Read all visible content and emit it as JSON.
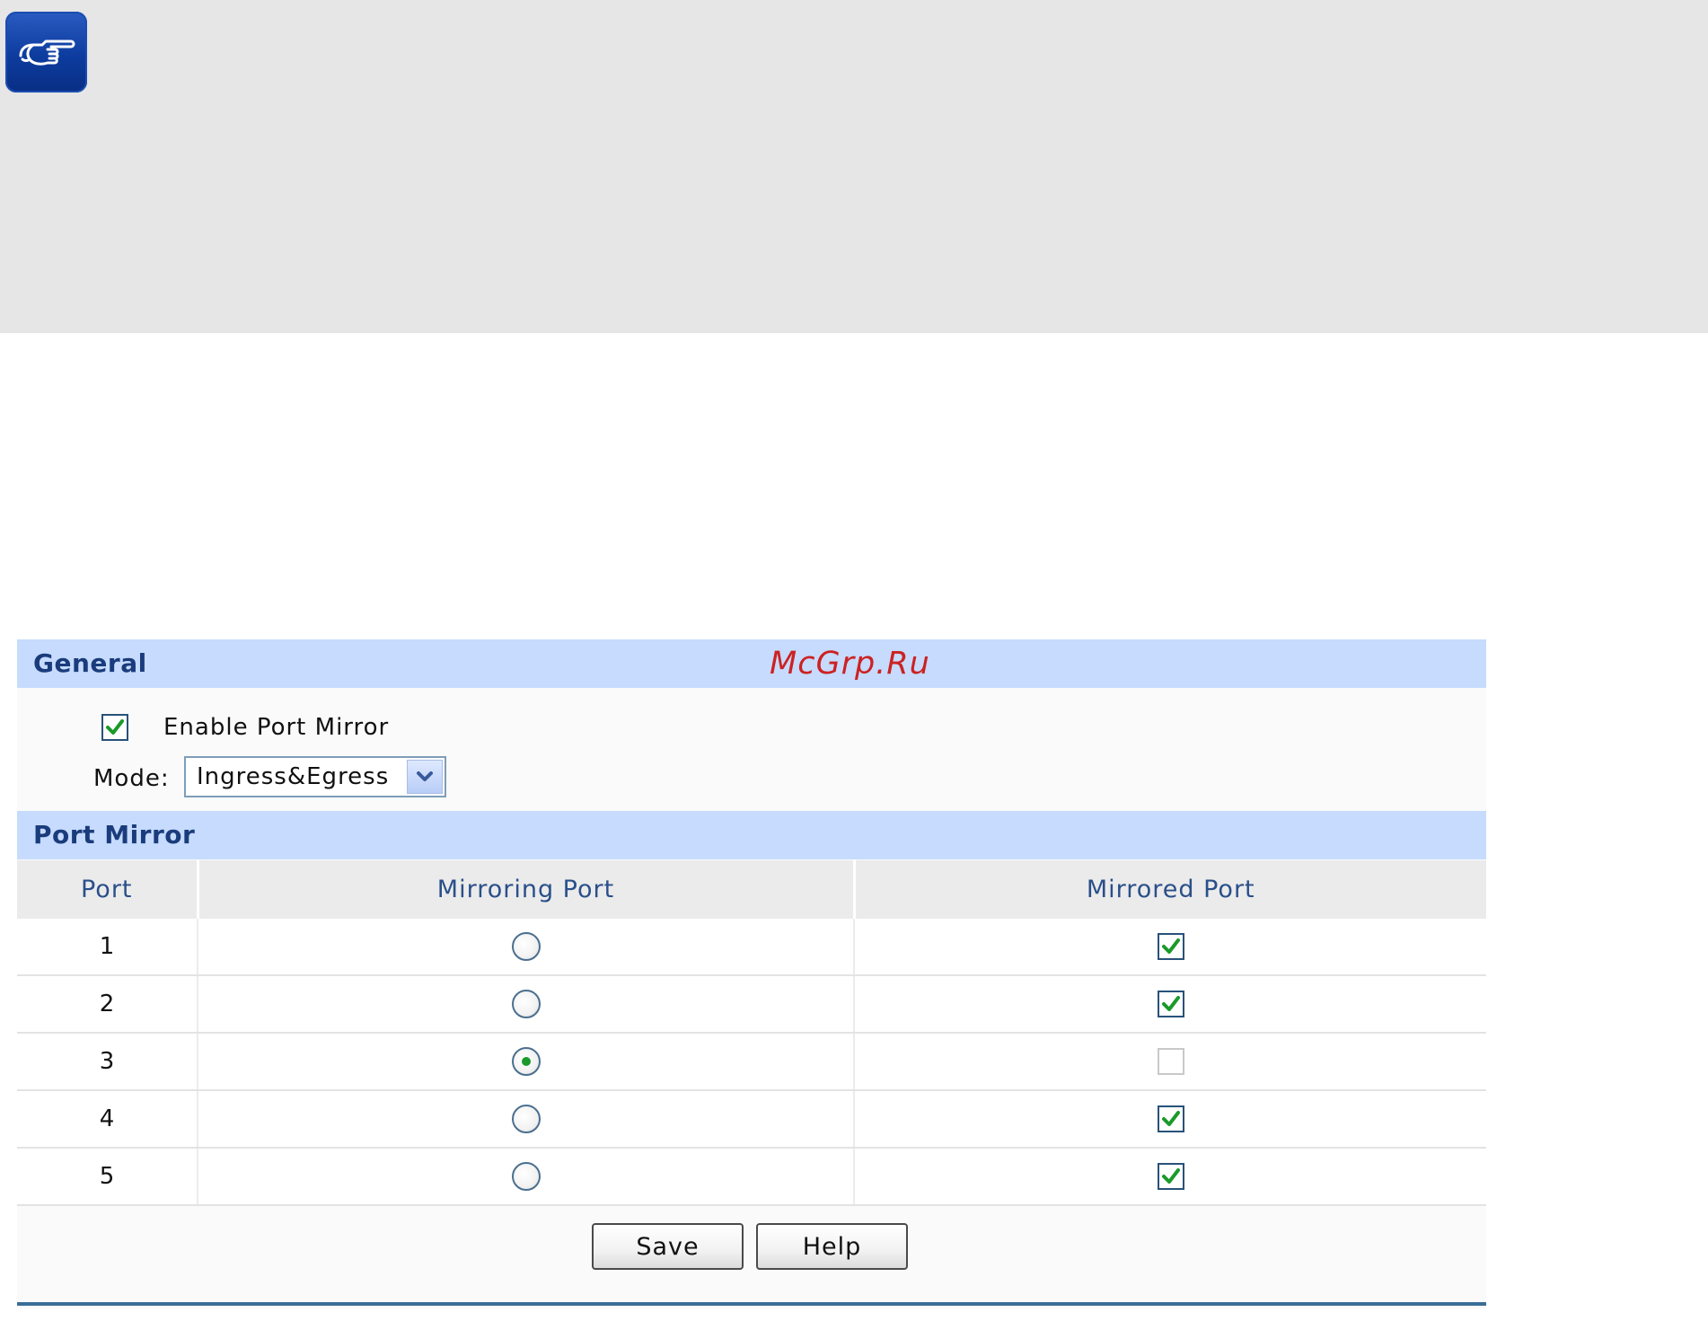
{
  "general": {
    "title": "General",
    "watermark": "McGrp.Ru",
    "enable_port_mirror": {
      "label": "Enable Port Mirror",
      "checked": true
    },
    "mode": {
      "label": "Mode:",
      "value": "Ingress&Egress"
    }
  },
  "port_mirror": {
    "title": "Port Mirror",
    "columns": {
      "port": "Port",
      "mirroring": "Mirroring Port",
      "mirrored": "Mirrored Port"
    },
    "rows": [
      {
        "port": "1",
        "mirroring_selected": false,
        "mirrored_checked": true
      },
      {
        "port": "2",
        "mirroring_selected": false,
        "mirrored_checked": true
      },
      {
        "port": "3",
        "mirroring_selected": true,
        "mirrored_checked": false
      },
      {
        "port": "4",
        "mirroring_selected": false,
        "mirrored_checked": true
      },
      {
        "port": "5",
        "mirroring_selected": false,
        "mirrored_checked": true
      }
    ]
  },
  "buttons": {
    "save": "Save",
    "help": "Help"
  },
  "colors": {
    "section_header": "#c6dbfd",
    "section_title": "#1a3c7c",
    "column_header_text": "#2a4f8a",
    "check_green": "#1a9a2a",
    "rule": "#3a6e96"
  },
  "icons": {
    "note": "pointing-hand-icon",
    "check": "checkmark-icon",
    "dropdown": "chevron-down-icon"
  }
}
